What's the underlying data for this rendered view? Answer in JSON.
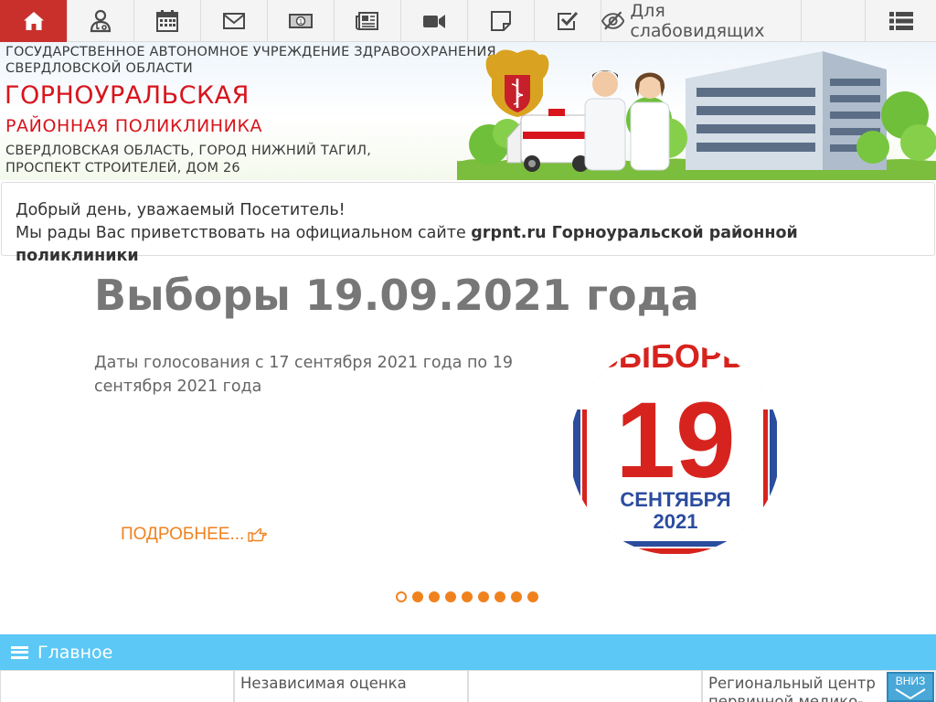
{
  "toolbar": {
    "accessibility_label": "Для слабовидящих"
  },
  "banner": {
    "org_line1": "ГОСУДАРСТВЕННОЕ АВТОНОМНОЕ УЧРЕЖДЕНИЕ ЗДРАВООХРАНЕНИЯ",
    "org_line2": "СВЕРДЛОВСКОЙ ОБЛАСТИ",
    "name_line1": "ГОРНОУРАЛЬСКАЯ",
    "name_line2": "РАЙОННАЯ ПОЛИКЛИНИКА",
    "address_line1": "СВЕРДЛОВСКАЯ ОБЛАСТЬ, ГОРОД НИЖНИЙ ТАГИЛ,",
    "address_line2": "ПРОСПЕКТ СТРОИТЕЛЕЙ, ДОМ 26"
  },
  "welcome": {
    "line1": "Добрый день, уважаемый Посетитель!",
    "line2_prefix": "Мы рады Вас приветствовать на официальном сайте ",
    "line2_bold": "grpnt.ru Горноуральской районной поликлиники"
  },
  "slide": {
    "title": "Выборы 19.09.2021 года",
    "text": "Даты голосования с 17 сентября 2021 года по 19 сентября 2021 года",
    "more_label": "ПОДРОБНЕЕ...",
    "image": {
      "top_word": "ВЫБОРЫ",
      "day": "19",
      "month": "СЕНТЯБРЯ",
      "year": "2021"
    }
  },
  "carousel": {
    "dot_count": 9,
    "active_index": 0
  },
  "mainbar": {
    "label": "Главное"
  },
  "tiles": [
    {
      "line1": "",
      "line2": ""
    },
    {
      "line1": "Независимая оценка",
      "line2": ""
    },
    {
      "line1": "",
      "line2": ""
    },
    {
      "line1": "Региональный центр",
      "line2": "первичной медико-"
    }
  ],
  "scroll_button": {
    "label": "ВНИЗ"
  },
  "colors": {
    "home_active": "#c9302c",
    "brand_red": "#d8141c",
    "accent_orange": "#f0821e",
    "nav_blue": "#5bc8f6"
  },
  "icons": [
    "home-icon",
    "doctor-icon",
    "calendar-icon",
    "envelope-icon",
    "money-icon",
    "newspaper-icon",
    "video-icon",
    "note-icon",
    "checkbox-icon",
    "eye-slash-icon",
    "list-menu-icon",
    "hand-pointer-icon"
  ]
}
